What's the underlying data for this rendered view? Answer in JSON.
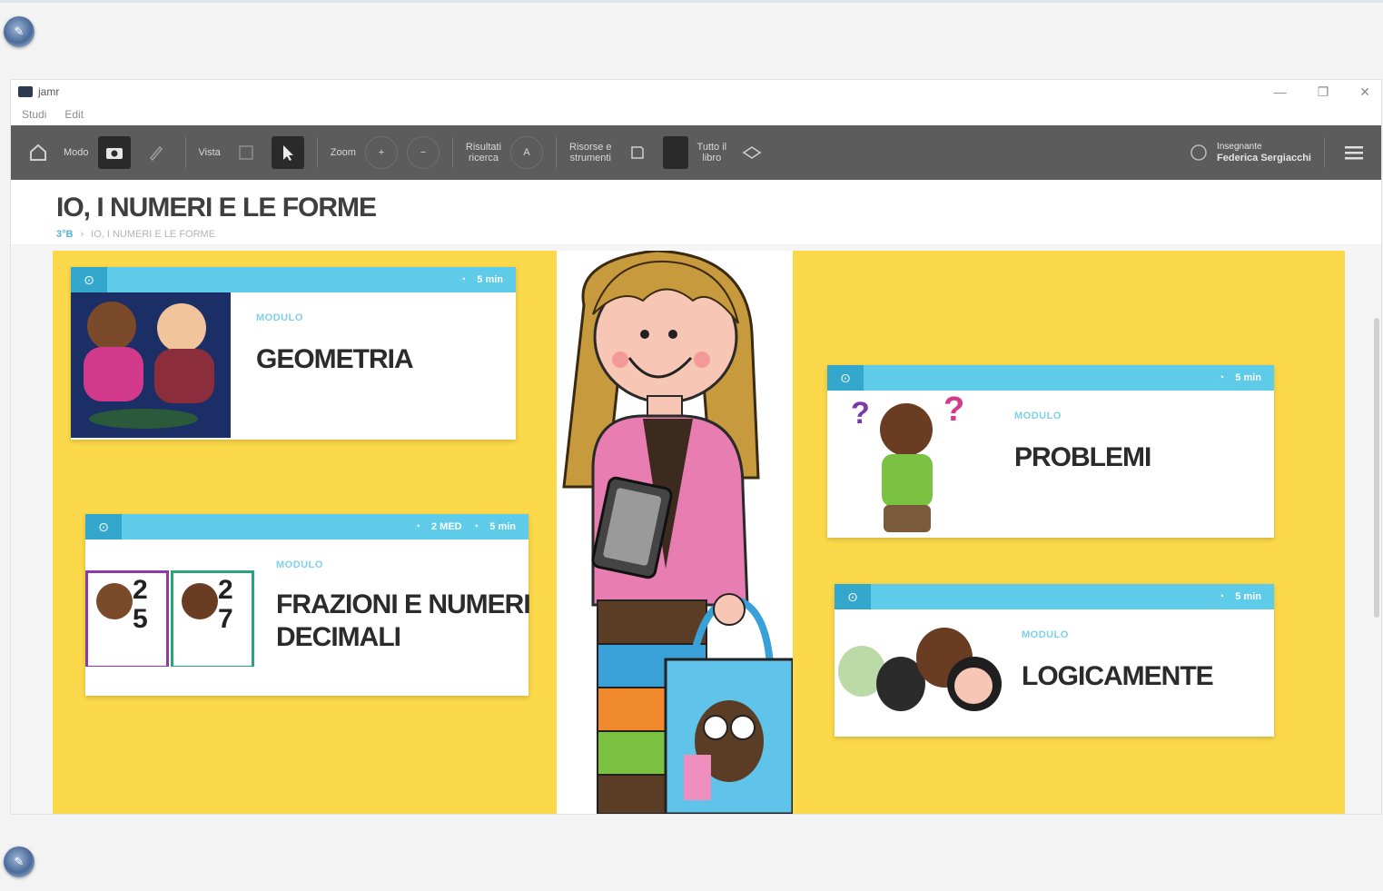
{
  "window": {
    "app_title": "jamr",
    "menu": [
      "Studi",
      "Edit"
    ],
    "controls": [
      "—",
      "❐",
      "✕"
    ]
  },
  "toolbar": {
    "mode_label": "Modo",
    "view_label": "Vista",
    "zoom_label": "Zoom",
    "text1": "Risultati\nricerca",
    "text2": "Risorse e\nstrumenti",
    "text3": "Tutto il\nlibro",
    "user_role": "Insegnante",
    "user_name": "Federica Sergiacchi"
  },
  "header": {
    "title": "IO, I NUMERI E LE FORME",
    "breadcrumb_home": "3°B",
    "breadcrumb_current": "IO, I NUMERI E LE FORME"
  },
  "cards": [
    {
      "kicker": "MODULO",
      "title": "GEOMETRIA",
      "meta": [
        "5 min"
      ]
    },
    {
      "kicker": "MODULO",
      "title": "FRAZIONI E NUMERI DECIMALI",
      "meta": [
        "2 MED",
        "5 min"
      ]
    },
    {
      "kicker": "MODULO",
      "title": "PROBLEMI",
      "meta": [
        "5 min"
      ]
    },
    {
      "kicker": "MODULO",
      "title": "LOGICAMENTE",
      "meta": [
        "5 min"
      ]
    }
  ],
  "colors": {
    "toolbar_bg": "#5c5c5c",
    "panel_yellow": "#fcd94a",
    "card_header": "#5ecbe8",
    "card_icon": "#34a8cc"
  },
  "icons": [
    "home-icon",
    "camera-icon",
    "pencil-icon",
    "grid-icon",
    "cursor-icon",
    "zoom-in-icon",
    "zoom-out-icon",
    "text-icon",
    "resource-icon",
    "book-icon",
    "user-icon",
    "hamburger-menu-icon",
    "clock-icon",
    "module-icon"
  ]
}
